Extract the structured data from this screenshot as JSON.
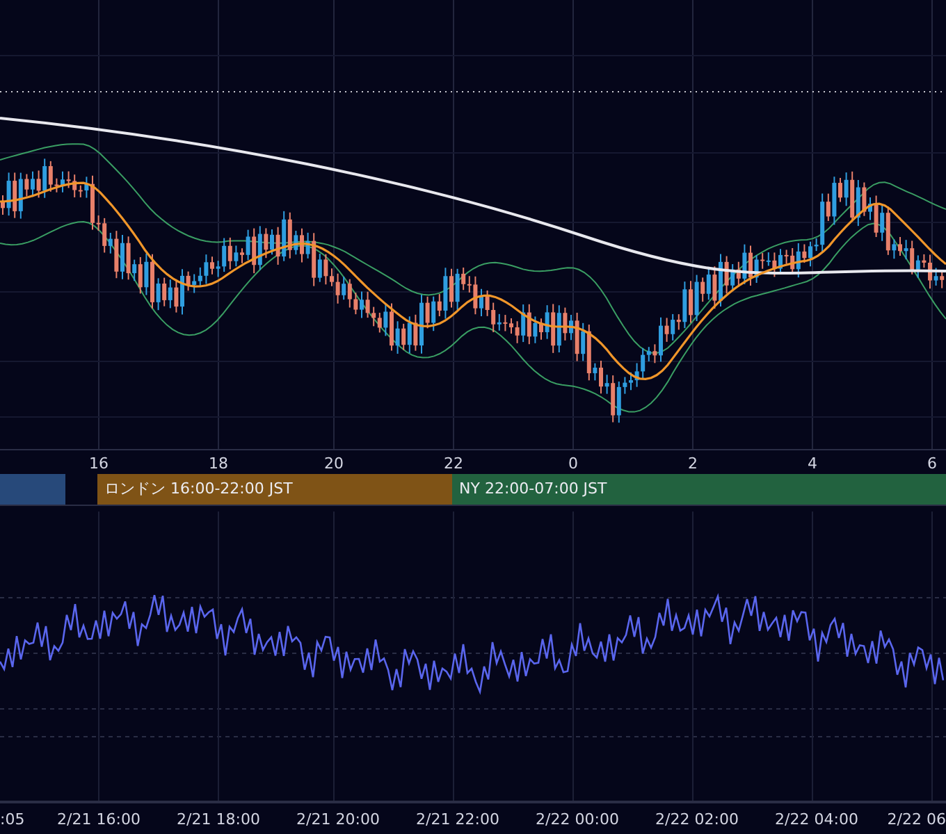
{
  "price_chart": {
    "x_axis_labels": [
      "16",
      "18",
      "20",
      "22",
      "0",
      "2",
      "4",
      "6"
    ]
  },
  "sessions": [
    {
      "color": "#27497a"
    },
    {
      "label": "ロンドン 16:00-22:00 JST",
      "color": "#7f5316"
    },
    {
      "label": "NY 22:00-07:00 JST",
      "color": "#22623f"
    }
  ],
  "time_axis_labels": [
    ":05",
    "2/21 16:00",
    "2/21 18:00",
    "2/21 20:00",
    "2/21 22:00",
    "2/22 00:00",
    "2/22 02:00",
    "2/22 04:00",
    "2/22 06"
  ]
}
